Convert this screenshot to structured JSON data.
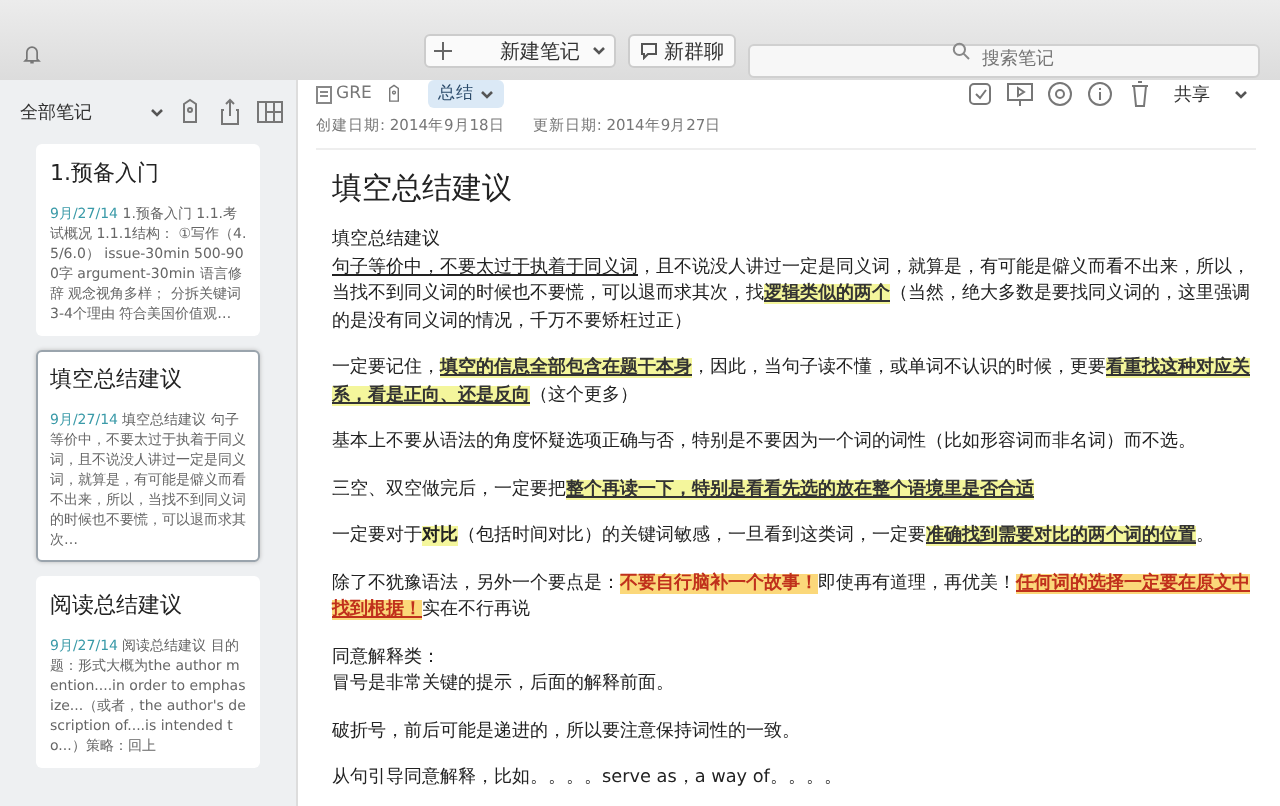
{
  "toolbar": {
    "new_note": {
      "label": "新建笔记"
    },
    "new_chat": {
      "label": "新群聊"
    },
    "search": {
      "placeholder": "搜索笔记"
    }
  },
  "sidebar": {
    "filter": "全部笔记",
    "notes": [
      {
        "title": "1.预备入门",
        "date": "9月/27/14",
        "snippet": "1.预备入门 1.1.考试概况 1.1.1结构： ①写作（4.5/6.0） issue-30min 500-900字 argument-30min 语言修辞 观念视角多样； 分拆关键词 3-4个理由 符合美国价值观…",
        "selected": false
      },
      {
        "title": "填空总结建议",
        "date": "9月/27/14",
        "snippet": "填空总结建议 句子等价中，不要太过于执着于同义词，且不说没人讲过一定是同义词，就算是，有可能是僻义而看不出来，所以，当找不到同义词的时候也不要慌，可以退而求其次…",
        "selected": true
      },
      {
        "title": "阅读总结建议",
        "date": "9月/27/14",
        "snippet": "阅读总结建议 目的题：形式大概为the author mention....in order to emphasize...（或者，the author's description of....is intended to...）策略：回上",
        "selected": false
      }
    ]
  },
  "note": {
    "notebook": "GRE",
    "tag": "总结",
    "share": "共享",
    "created": "创建日期: 2014年9月18日",
    "updated": "更新日期: 2014年9月27日",
    "title": "填空总结建议",
    "paragraphs": [
      {
        "kind": "lead",
        "segments": [
          {
            "kind": "plain",
            "text": "填空总结建议"
          }
        ]
      },
      {
        "kind": "body",
        "segments": [
          {
            "kind": "underline",
            "text": "句子等价中，不要太过于执着于同义词"
          },
          {
            "kind": "plain",
            "text": "，且不说没人讲过一定是同义词，就算是，有可能是僻义而看不出来，所以，当找不到同义词的时候也不要慌，可以退而求其次，找"
          },
          {
            "kind": "mark",
            "text": "逻辑类似的两个"
          },
          {
            "kind": "plain",
            "text": "（当然，绝大多数是要找同义词的，这里强调的是没有同义词的情况，千万不要矫枉过正）"
          }
        ]
      },
      {
        "kind": "body",
        "segments": [
          {
            "kind": "plain",
            "text": "一定要记住，"
          },
          {
            "kind": "mark",
            "text": "填空的信息全部包含在题干本身"
          },
          {
            "kind": "plain",
            "text": "，因此，当句子读不懂，或单词不认识的时候，更要"
          },
          {
            "kind": "mark",
            "text": "看重找这种对应关系，看是正向、还是反向"
          },
          {
            "kind": "plain",
            "text": "（这个更多）"
          }
        ]
      },
      {
        "kind": "body",
        "segments": [
          {
            "kind": "plain",
            "text": "基本上不要从语法的角度怀疑选项正确与否，特别是不要因为一个词的词性（比如形容词而非名词）而不选。"
          }
        ]
      },
      {
        "kind": "body",
        "segments": [
          {
            "kind": "plain",
            "text": "三空、双空做完后，一定要把"
          },
          {
            "kind": "mark",
            "text": "整个再读一下，特别是看看先选的放在整个语境里是否合适"
          }
        ]
      },
      {
        "kind": "body",
        "segments": [
          {
            "kind": "plain",
            "text": "一定要对于"
          },
          {
            "kind": "glow",
            "text": "对比"
          },
          {
            "kind": "plain",
            "text": "（包括时间对比）的关键词敏感，一旦看到这类词，一定要"
          },
          {
            "kind": "mark",
            "text": "准确找到需要对比的两个词的位置"
          },
          {
            "kind": "plain",
            "text": "。"
          }
        ]
      },
      {
        "kind": "body",
        "segments": [
          {
            "kind": "plain",
            "text": "除了不犹豫语法，另外一个要点是："
          },
          {
            "kind": "alert",
            "text": "不要自行脑补一个故事！"
          },
          {
            "kind": "plain",
            "text": "即使再有道理，再优美！"
          },
          {
            "kind": "alert-underline",
            "text": "任何词的选择一定要在原文中找到根据！"
          },
          {
            "kind": "plain",
            "text": "实在不行再说"
          }
        ]
      },
      {
        "kind": "lead",
        "segments": [
          {
            "kind": "plain",
            "text": "同意解释类："
          }
        ]
      },
      {
        "kind": "body",
        "segments": [
          {
            "kind": "plain",
            "text": "冒号是非常关键的提示，后面的解释前面。"
          }
        ]
      },
      {
        "kind": "body",
        "segments": [
          {
            "kind": "plain",
            "text": "破折号，前后可能是递进的，所以要注意保持词性的一致。"
          }
        ]
      },
      {
        "kind": "body",
        "segments": [
          {
            "kind": "plain",
            "text": "从句引导同意解释，比如。。。。serve as，a way of。。。。"
          }
        ]
      }
    ]
  }
}
